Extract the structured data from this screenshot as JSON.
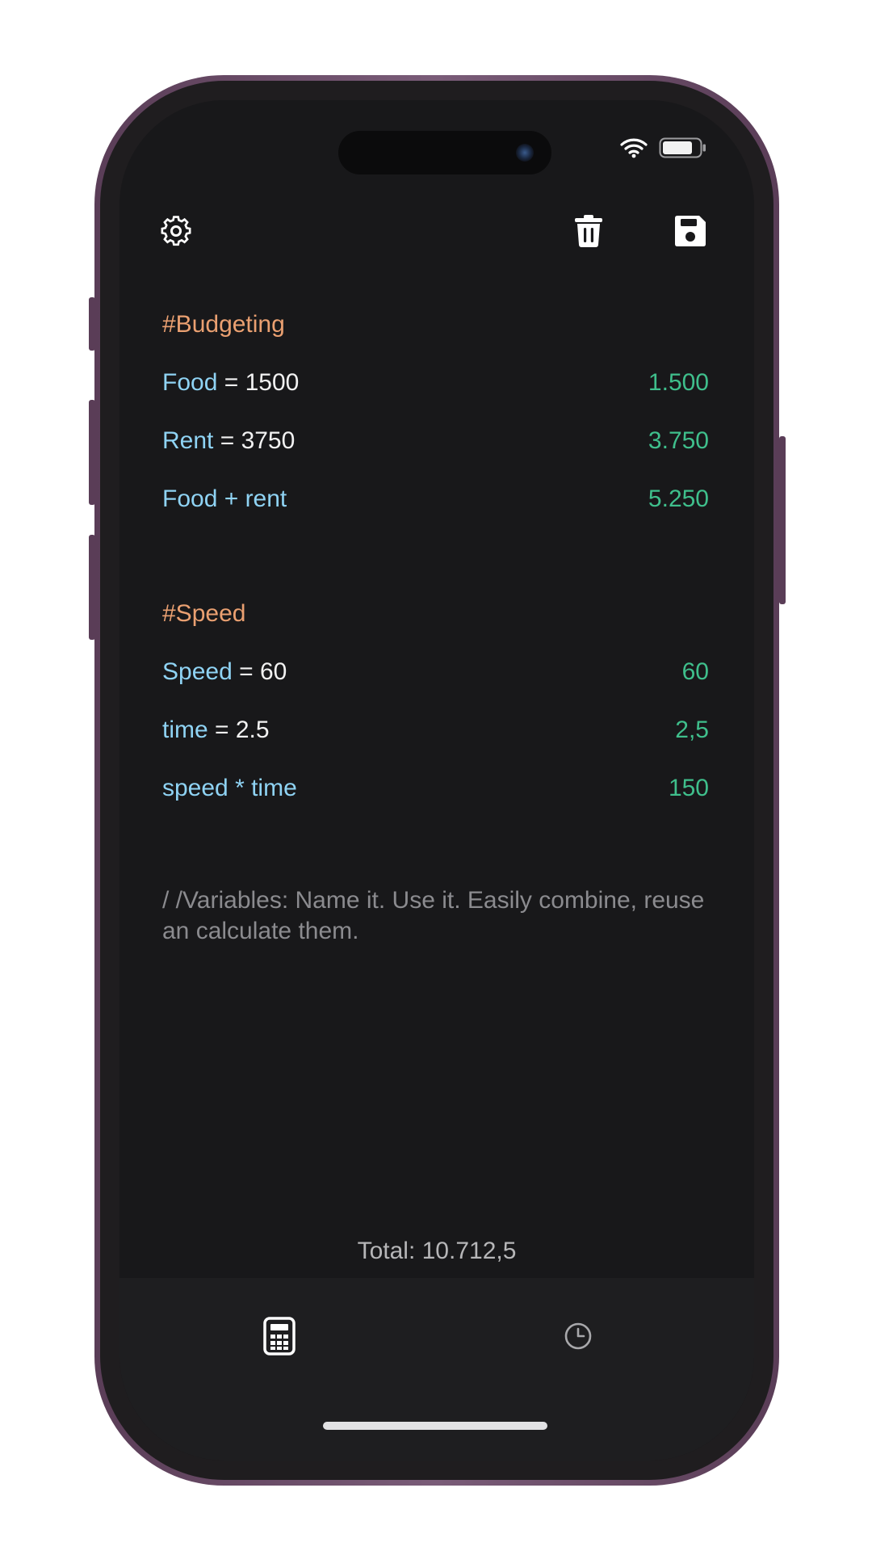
{
  "toolbar": {
    "settings_icon": "gear-icon",
    "trash_icon": "trash-icon",
    "save_icon": "floppy-disk-icon"
  },
  "sections": [
    {
      "heading": "#Budgeting",
      "rows": [
        {
          "var": "Food",
          "rest": " = 1500",
          "result": "1.500"
        },
        {
          "var": "Rent",
          "rest": " = 3750",
          "result": "3.750"
        },
        {
          "var": "Food + rent",
          "rest": "",
          "result": "5.250"
        }
      ]
    },
    {
      "heading": "#Speed",
      "rows": [
        {
          "var": "Speed",
          "rest": " = 60",
          "result": "60"
        },
        {
          "var": "time",
          "rest": " = 2.5",
          "result": "2,5"
        },
        {
          "var": "speed * time",
          "rest": "",
          "result": "150"
        }
      ]
    }
  ],
  "comment": "/ /Variables: Name it. Use it. Easily combine, reuse an calculate them.",
  "total": "Total: 10.712,5",
  "tabs": [
    {
      "icon": "calculator-icon",
      "active": true
    },
    {
      "icon": "clock-icon",
      "active": false
    }
  ],
  "colors": {
    "heading": "#eaa071",
    "variable": "#8fd3f4",
    "result": "#3fbf8c",
    "comment": "#8b8b8f",
    "background": "#18181a"
  }
}
